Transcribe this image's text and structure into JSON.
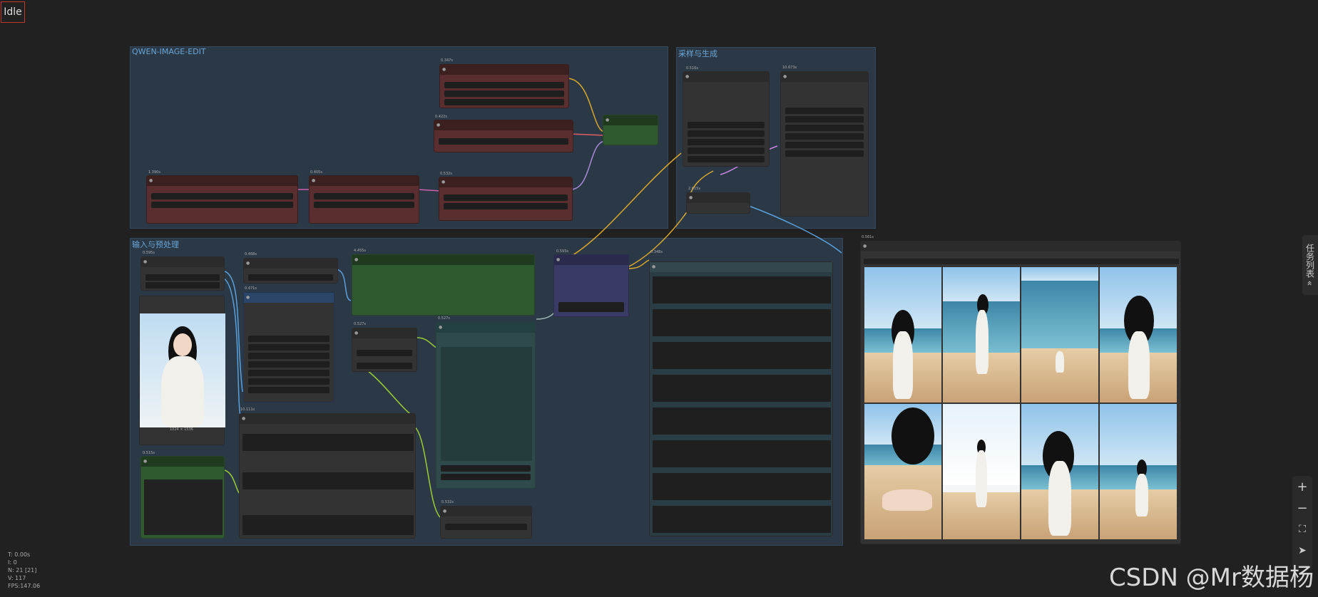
{
  "status": "Idle",
  "groups": {
    "qwen": "QWEN-IMAGE-EDIT",
    "sampler": "采样与生成",
    "input": "输入与预处理"
  },
  "timings": {
    "t1": "0.347s",
    "t2": "0.422s",
    "t3": "1.390s",
    "t4": "0.405s",
    "t5": "0.532s",
    "t6": "0.516s",
    "t7": "10.673s",
    "t8": "2.615s",
    "t9": "0.595s",
    "t10": "0.468s",
    "t11": "0.471s",
    "t12": "4.455s",
    "t13": "0.593s",
    "t14": "0.348s",
    "t15": "0.527s",
    "t16": "0.527s",
    "t17": "10.111s",
    "t18": "0.515s",
    "t19": "0.532s",
    "t20": "0.561s"
  },
  "input_image_caption": "1024 × 1536",
  "stats": [
    "T: 0.00s",
    "I: 0",
    "N: 21 [21]",
    "V: 117",
    "FPS:147.06"
  ],
  "toolbar": {
    "zoom_in": "+",
    "zoom_out": "−",
    "fit": "⛶",
    "pointer": "➤"
  },
  "side_tab": "任务列表 «",
  "watermark": "CSDN @Mr数据杨",
  "colors": {
    "accent_red": "#c0392b",
    "group_title": "#6aa6d6"
  }
}
